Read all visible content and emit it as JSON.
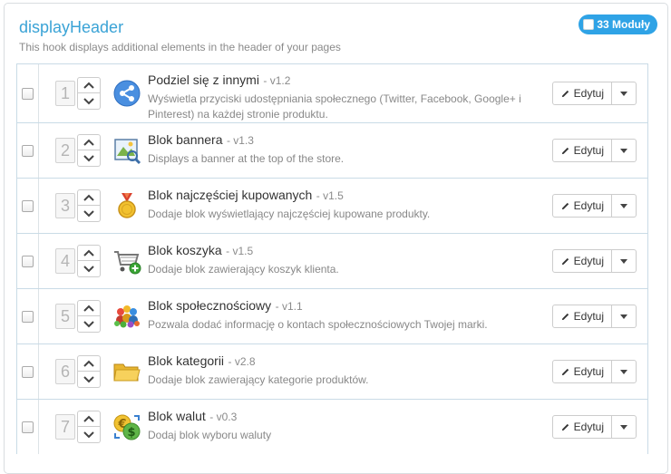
{
  "hook": {
    "title": "displayHeader",
    "subtitle": "This hook displays additional elements in the header of your pages",
    "badge": "33 Moduły"
  },
  "modules": [
    {
      "pos": "1",
      "name": "Podziel się z innymi",
      "version": "- v1.2",
      "desc": "Wyświetla przyciski udostępniania społecznego (Twitter, Facebook, Google+ i Pinterest) na każdej stronie produktu.",
      "icon": "share-icon",
      "edit": "Edytuj"
    },
    {
      "pos": "2",
      "name": "Blok bannera",
      "version": "- v1.3",
      "desc": "Displays a banner at the top of the store.",
      "icon": "banner-icon",
      "edit": "Edytuj"
    },
    {
      "pos": "3",
      "name": "Blok najczęściej kupowanych",
      "version": "- v1.5",
      "desc": "Dodaje blok wyświetlający najczęściej kupowane produkty.",
      "icon": "medal-icon",
      "edit": "Edytuj"
    },
    {
      "pos": "4",
      "name": "Blok koszyka",
      "version": "- v1.5",
      "desc": "Dodaje blok zawierający koszyk klienta.",
      "icon": "cart-icon",
      "edit": "Edytuj"
    },
    {
      "pos": "5",
      "name": "Blok społecznościowy",
      "version": "- v1.1",
      "desc": "Pozwala dodać informację o kontach społecznościowych Twojej marki.",
      "icon": "people-icon",
      "edit": "Edytuj"
    },
    {
      "pos": "6",
      "name": "Blok kategorii",
      "version": "- v2.8",
      "desc": "Dodaje blok zawierający kategorie produktów.",
      "icon": "folder-icon",
      "edit": "Edytuj"
    },
    {
      "pos": "7",
      "name": "Blok walut",
      "version": "- v0.3",
      "desc": "Dodaj blok wyboru waluty",
      "icon": "currency-icon",
      "edit": "Edytuj"
    }
  ]
}
